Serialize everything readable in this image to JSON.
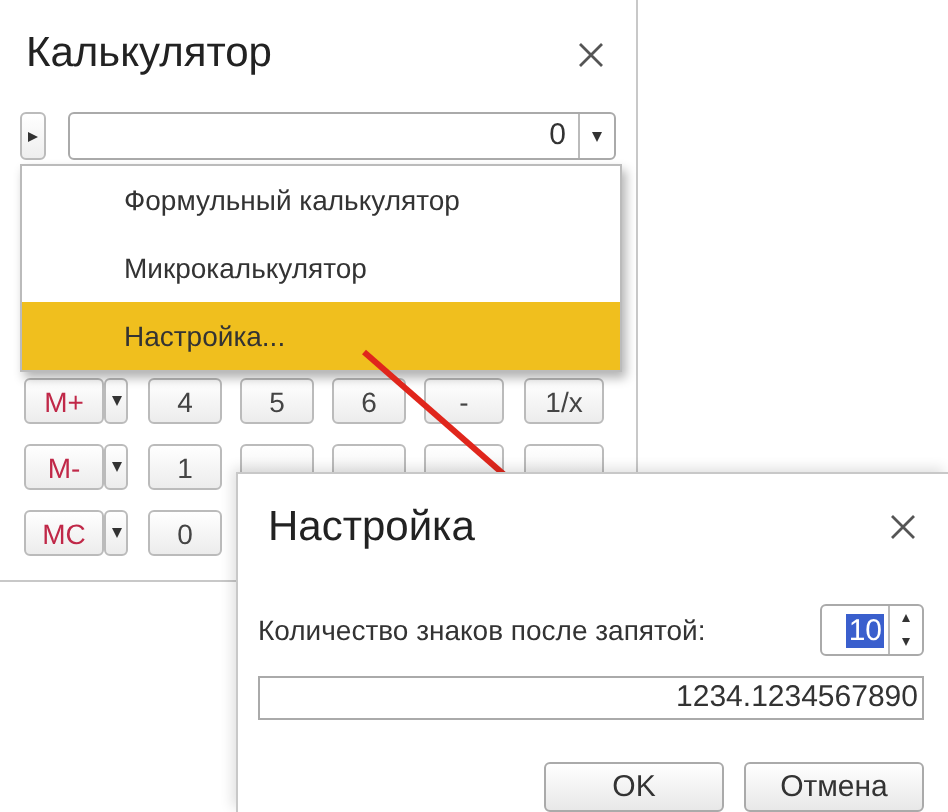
{
  "calculator": {
    "title": "Калькулятор",
    "display": {
      "value": "0"
    },
    "menu": {
      "items": [
        {
          "label": "Формульный калькулятор",
          "selected": false
        },
        {
          "label": "Микрокалькулятор",
          "selected": false
        },
        {
          "label": "Настройка...",
          "selected": true
        }
      ]
    },
    "key_rows": [
      [
        {
          "kind": "memory",
          "label": "M+"
        },
        {
          "kind": "dropdown"
        },
        {
          "kind": "digit",
          "label": "4"
        },
        {
          "kind": "digit",
          "label": "5"
        },
        {
          "kind": "digit",
          "label": "6"
        },
        {
          "kind": "operator",
          "label": "-"
        },
        {
          "kind": "operator",
          "label": "1/x"
        }
      ],
      [
        {
          "kind": "memory",
          "label": "M-"
        },
        {
          "kind": "dropdown"
        },
        {
          "kind": "digit",
          "label": "1"
        },
        {
          "kind": "digit"
        },
        {
          "kind": "digit"
        },
        {
          "kind": "operator"
        },
        {
          "kind": "operator"
        }
      ],
      [
        {
          "kind": "memory",
          "label": "MC"
        },
        {
          "kind": "dropdown"
        },
        {
          "kind": "digit",
          "label": "0"
        }
      ]
    ]
  },
  "dialog": {
    "title": "Настройка",
    "digits_label": "Количество знаков после запятой:",
    "digits": {
      "value": "10",
      "selected": true
    },
    "preview": "1234.1234567890",
    "buttons": [
      "OK",
      "Отмена"
    ]
  }
}
